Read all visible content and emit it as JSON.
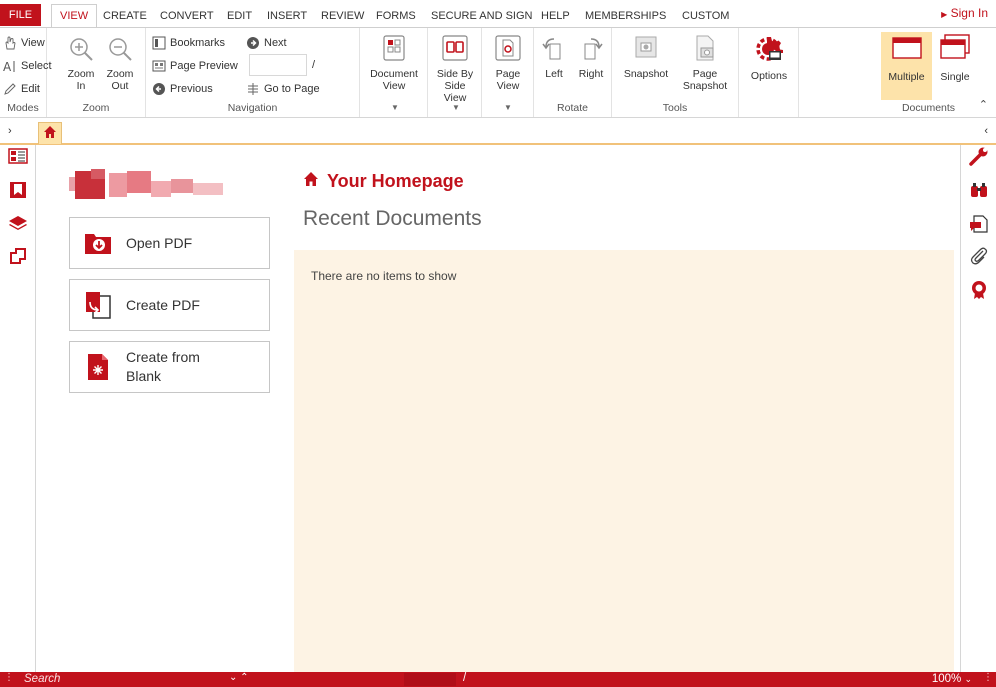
{
  "menu": {
    "file": "FILE",
    "tabs": [
      "VIEW",
      "CREATE",
      "CONVERT",
      "EDIT",
      "INSERT",
      "REVIEW",
      "FORMS",
      "SECURE AND SIGN",
      "HELP",
      "MEMBERSHIPS",
      "CUSTOM"
    ],
    "signin": "Sign In"
  },
  "ribbon": {
    "modes": {
      "view": "View",
      "select": "Select",
      "edit": "Edit",
      "label": "Modes"
    },
    "zoom": {
      "in_line1": "Zoom",
      "in_line2": "In",
      "out_line1": "Zoom",
      "out_line2": "Out",
      "label": "Zoom"
    },
    "navigation": {
      "bookmarks": "Bookmarks",
      "page_preview": "Page Preview",
      "previous": "Previous",
      "next": "Next",
      "page_separator": "/",
      "go_to_page": "Go to Page",
      "page_value": "",
      "label": "Navigation"
    },
    "document_view": {
      "line1": "Document",
      "line2": "View"
    },
    "side_by_side": {
      "line1": "Side By",
      "line2": "Side",
      "line3": "View"
    },
    "page_view": {
      "line1": "Page",
      "line2": "View"
    },
    "rotate": {
      "left": "Left",
      "right": "Right",
      "label": "Rotate"
    },
    "tools": {
      "snapshot": "Snapshot",
      "page_snapshot_line1": "Page",
      "page_snapshot_line2": "Snapshot",
      "label": "Tools"
    },
    "options": "Options",
    "documents": {
      "multiple": "Multiple",
      "single": "Single",
      "label": "Documents"
    }
  },
  "home": {
    "title": "Your Homepage",
    "recent_title": "Recent Documents",
    "empty_message": "There are no items to show",
    "actions": [
      {
        "line1": "Open PDF",
        "line2": ""
      },
      {
        "line1": "Create PDF",
        "line2": ""
      },
      {
        "line1": "Create from",
        "line2": "Blank"
      }
    ]
  },
  "statusbar": {
    "search_placeholder": "Search",
    "page_separator": "/",
    "zoom": "100%"
  },
  "colors": {
    "brand_red": "#c1121c",
    "panel_bg": "#fdf3e4",
    "active_yellow": "#fde3aa",
    "tab_underline": "#f1c27a"
  }
}
